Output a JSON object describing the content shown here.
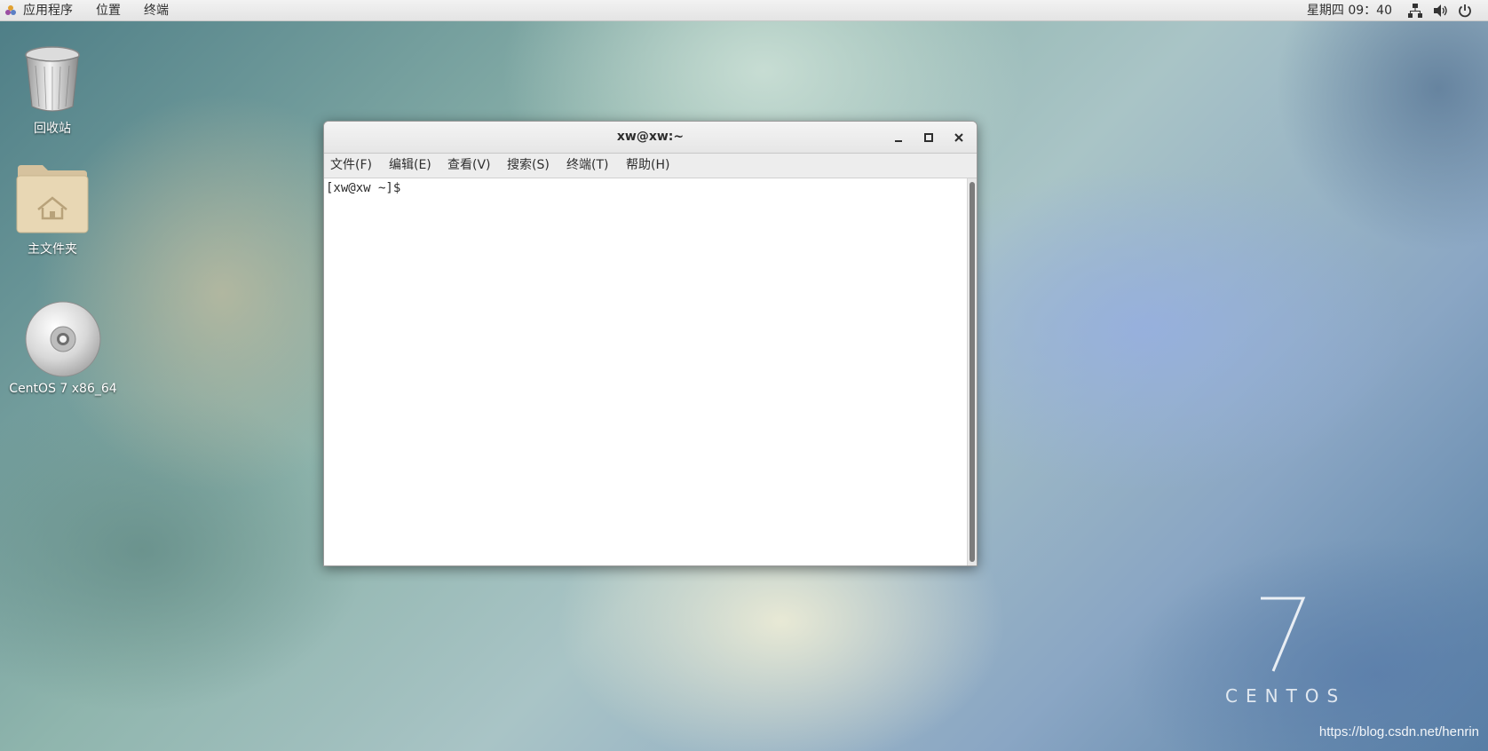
{
  "top_panel": {
    "menus": [
      "应用程序",
      "位置",
      "终端"
    ],
    "clock": "星期四 09：40",
    "tray_icons": [
      "network-icon",
      "volume-icon",
      "power-icon"
    ]
  },
  "desktop_icons": [
    {
      "label": "回收站",
      "icon": "trash-icon"
    },
    {
      "label": "主文件夹",
      "icon": "home-folder-icon"
    },
    {
      "label": "CentOS 7 x86_64",
      "icon": "disc-icon"
    }
  ],
  "terminal": {
    "title": "xw@xw:~",
    "menu": [
      "文件(F)",
      "编辑(E)",
      "查看(V)",
      "搜索(S)",
      "终端(T)",
      "帮助(H)"
    ],
    "prompt": "[xw@xw ~]$"
  },
  "branding": {
    "version_mark": "7",
    "word": "CENTOS"
  },
  "watermark": "https://blog.csdn.net/henrin"
}
